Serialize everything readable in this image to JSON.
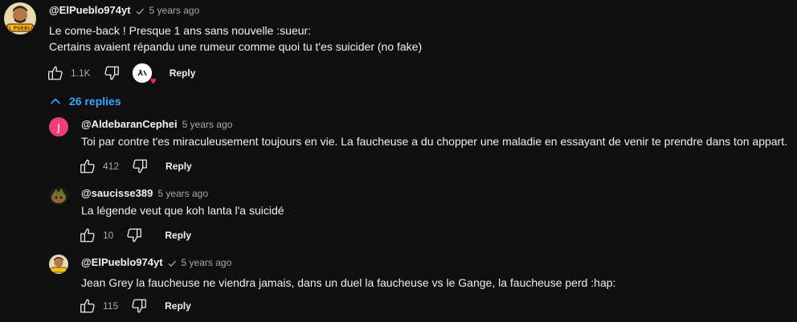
{
  "thread": {
    "top_comment": {
      "author": "@ElPueblo974yt",
      "verified_icon": "check-icon",
      "time": "5 years ago",
      "lines": [
        "Le come-back ! Presque 1 ans sans nouvelle :sueur:",
        "Certains avaient répandu une rumeur comme quoi tu t'es suicider (no fake)"
      ],
      "likes": "1.1K",
      "reply_label": "Reply",
      "hearted": true
    },
    "replies_toggle": {
      "icon": "chevron-up-icon",
      "label": "26 replies"
    },
    "replies": [
      {
        "author": "@AldebaranCephei",
        "time": "5 years ago",
        "avatar_letter": "J",
        "avatar_color": "#ec407a",
        "text": "Toi par contre t'es miraculeusement toujours en vie. La faucheuse a du chopper une maladie en essayant de venir te prendre dans ton appart.",
        "likes": "412",
        "reply_label": "Reply"
      },
      {
        "author": "@saucisse389",
        "time": "5 years ago",
        "text": "La légende veut que koh lanta l'a suicidé",
        "likes": "10",
        "reply_label": "Reply"
      },
      {
        "author": "@ElPueblo974yt",
        "verified_icon": "check-icon",
        "time": "5 years ago",
        "text": "Jean Grey  la faucheuse ne viendra jamais, dans un duel la faucheuse vs le Gange, la faucheuse perd :hap:",
        "likes": "115",
        "reply_label": "Reply"
      }
    ]
  },
  "colors": {
    "background": "#0f0f0f",
    "text": "#f1f1f1",
    "secondary_text": "#aaaaaa",
    "link": "#3ea6ff",
    "heart": "#ff2a44"
  }
}
